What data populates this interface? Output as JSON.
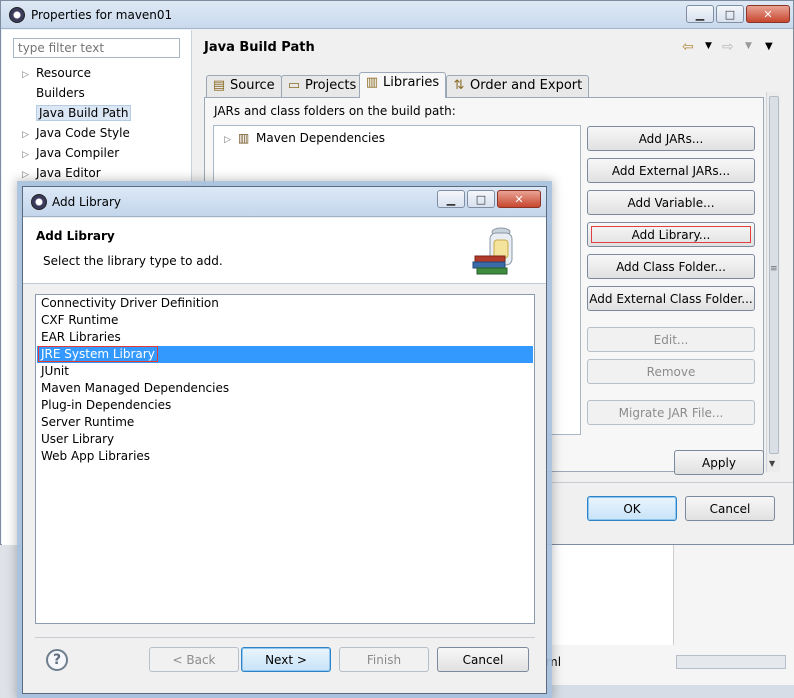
{
  "props_window": {
    "title": "Properties for maven01",
    "filter_placeholder": "type filter text",
    "tree": [
      "Resource",
      "Builders",
      "Java Build Path",
      "Java Code Style",
      "Java Compiler",
      "Java Editor"
    ],
    "selected_tree_item": "Java Build Path",
    "page_title": "Java Build Path",
    "tabs": [
      "Source",
      "Projects",
      "Libraries",
      "Order and Export"
    ],
    "active_tab": "Libraries",
    "jar_label": "JARs and class folders on the build path:",
    "jar_entries": [
      "Maven Dependencies"
    ],
    "buttons": {
      "add_jars": "Add JARs...",
      "add_external_jars": "Add External JARs...",
      "add_variable": "Add Variable...",
      "add_library": "Add Library...",
      "add_class_folder": "Add Class Folder...",
      "add_external_class_folder": "Add External Class Folder...",
      "edit": "Edit...",
      "remove": "Remove",
      "migrate": "Migrate JAR File...",
      "apply": "Apply",
      "ok": "OK",
      "cancel": "Cancel"
    }
  },
  "dialog": {
    "title": "Add Library",
    "header_title": "Add Library",
    "header_desc": "Select the library type to add.",
    "libraries": [
      "Connectivity Driver Definition",
      "CXF Runtime",
      "EAR Libraries",
      "JRE System Library",
      "JUnit",
      "Maven Managed Dependencies",
      "Plug-in Dependencies",
      "Server Runtime",
      "User Library",
      "Web App Libraries"
    ],
    "selected_library": "JRE System Library",
    "buttons": {
      "back": "< Back",
      "next": "Next >",
      "finish": "Finish",
      "cancel": "Cancel"
    }
  },
  "background": {
    "partial_text": "ml"
  },
  "colors": {
    "selection": "#3399ff",
    "highlight_border": "#e03a3a"
  }
}
